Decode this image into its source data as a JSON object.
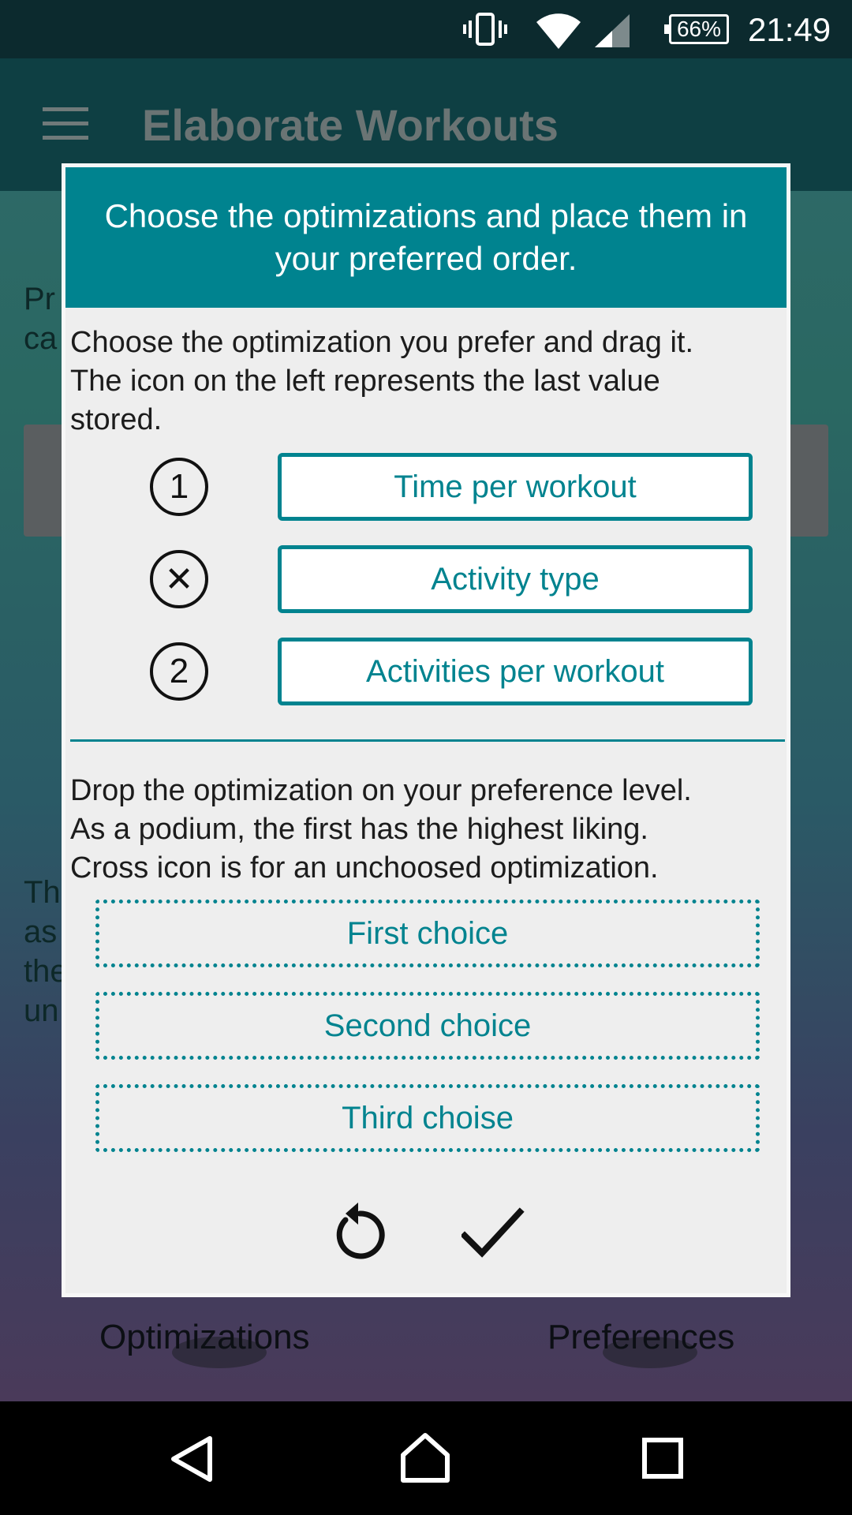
{
  "status_bar": {
    "battery": "66%",
    "time": "21:49",
    "icons": [
      "vibrate-icon",
      "wifi-icon",
      "signal-icon",
      "battery-icon"
    ]
  },
  "app": {
    "title": "Elaborate Workouts",
    "bg_text_1": [
      "Pr",
      "ca"
    ],
    "bg_text_2": [
      "Th",
      "as",
      "the",
      "un"
    ],
    "bottom_labels": {
      "left": "Optimizations",
      "right": "Preferences"
    }
  },
  "dialog": {
    "header": "Choose the optimizations and place them in your preferred order.",
    "instructions_1": [
      "Choose the optimization you prefer and drag it.",
      "The icon on the left represents the last value",
      "stored."
    ],
    "options": [
      {
        "icon_text": "1",
        "icon": "circled-number-icon",
        "label": "Time per workout"
      },
      {
        "icon_text": "✕",
        "icon": "circled-cross-icon",
        "label": "Activity type"
      },
      {
        "icon_text": "2",
        "icon": "circled-number-icon",
        "label": "Activities per workout"
      }
    ],
    "instructions_2": [
      "Drop the optimization on your preference level.",
      "As a podium, the first has the highest liking.",
      "Cross icon is for an unchoosed optimization."
    ],
    "drop_zones": [
      "First choice",
      "Second choice",
      "Third choise"
    ],
    "actions": [
      "reset-icon",
      "confirm-check-icon"
    ]
  },
  "colors": {
    "accent": "#00838f",
    "status_bar": "#0c2a2e",
    "toolbar": "#0e3f43",
    "dialog_bg": "#eeeeee"
  }
}
